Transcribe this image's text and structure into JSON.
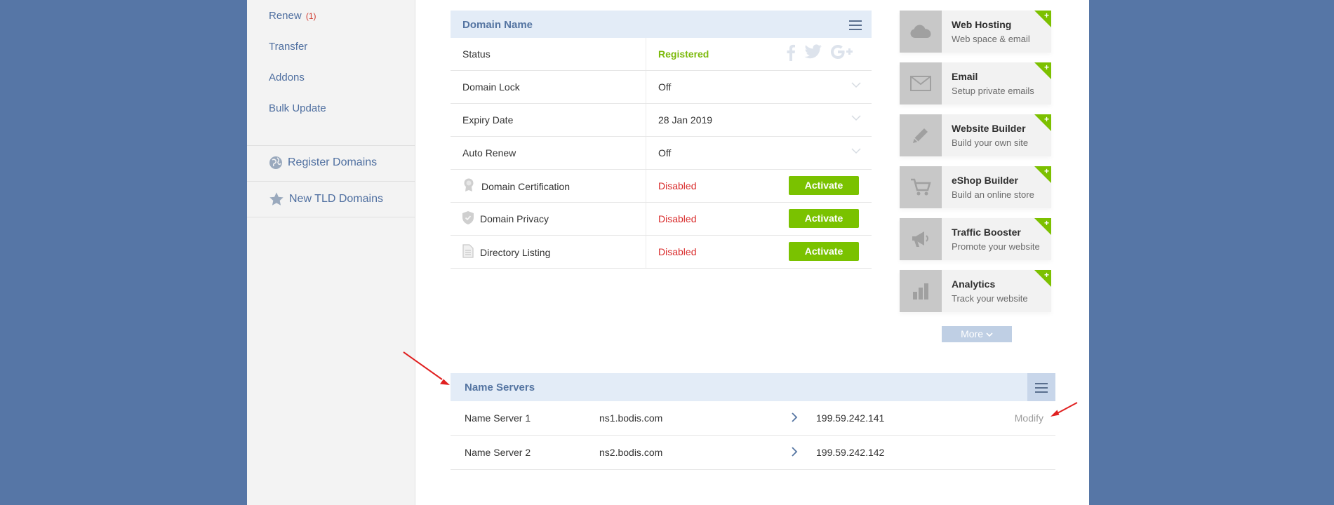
{
  "sidebar": {
    "links": [
      {
        "label": "Renew",
        "count": "(1)"
      },
      {
        "label": "Transfer"
      },
      {
        "label": "Addons"
      },
      {
        "label": "Bulk Update"
      }
    ],
    "register": "Register Domains",
    "new_tld": "New TLD Domains"
  },
  "domain_panel": {
    "title": "Domain Name",
    "rows": [
      {
        "label": "Status",
        "value": "Registered"
      },
      {
        "label": "Domain Lock",
        "value": "Off"
      },
      {
        "label": "Expiry Date",
        "value": "28 Jan 2019"
      },
      {
        "label": "Auto Renew",
        "value": "Off"
      },
      {
        "label": "Domain Certification",
        "value": "Disabled",
        "action": "Activate"
      },
      {
        "label": "Domain Privacy",
        "value": "Disabled",
        "action": "Activate"
      },
      {
        "label": "Directory Listing",
        "value": "Disabled",
        "action": "Activate"
      }
    ]
  },
  "addons": [
    {
      "title": "Web Hosting",
      "sub": "Web space & email",
      "icon": "cloud-icon"
    },
    {
      "title": "Email",
      "sub": "Setup private emails",
      "icon": "envelope-icon"
    },
    {
      "title": "Website Builder",
      "sub": "Build your own site",
      "icon": "pencil-icon"
    },
    {
      "title": "eShop Builder",
      "sub": "Build an online store",
      "icon": "cart-icon"
    },
    {
      "title": "Traffic Booster",
      "sub": "Promote your website",
      "icon": "megaphone-icon"
    },
    {
      "title": "Analytics",
      "sub": "Track your website",
      "icon": "bar-chart-icon"
    }
  ],
  "addon_plus": "+",
  "more_label": "More",
  "name_servers": {
    "title": "Name Servers",
    "rows": [
      {
        "label": "Name Server 1",
        "host": "ns1.bodis.com",
        "ip": "199.59.242.141",
        "action": "Modify"
      },
      {
        "label": "Name Server 2",
        "host": "ns2.bodis.com",
        "ip": "199.59.242.142"
      }
    ]
  },
  "colors": {
    "background": "#5676a6",
    "accent_green": "#7ac200",
    "status_red": "#d92c2c",
    "header_blue": "#e3ecf7",
    "link_blue": "#4f6fa0",
    "annotation_red": "#e02020"
  }
}
